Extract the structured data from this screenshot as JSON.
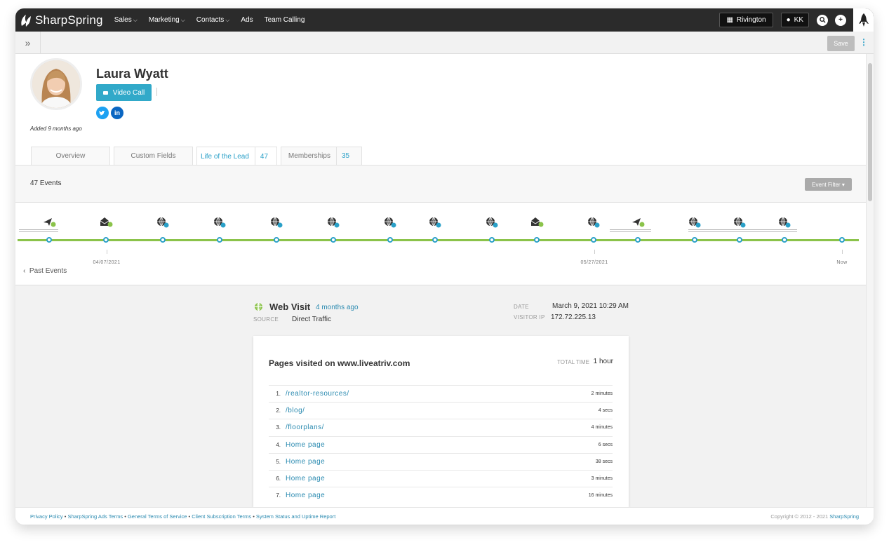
{
  "app": {
    "logo_text": "SharpSpring"
  },
  "nav": {
    "items": [
      {
        "label": "Sales",
        "dropdown": true
      },
      {
        "label": "Marketing",
        "dropdown": true
      },
      {
        "label": "Contacts",
        "dropdown": true
      },
      {
        "label": "Ads",
        "dropdown": false
      },
      {
        "label": "Team Calling",
        "dropdown": false
      }
    ],
    "company": "Rivington",
    "user_initials": "KK"
  },
  "toolbar": {
    "expand_label": "»",
    "save_label": "Save"
  },
  "contact": {
    "name": "Laura Wyatt",
    "video_call_label": "Video Call",
    "added": "Added 9 months ago",
    "social": [
      "twitter",
      "linkedin"
    ]
  },
  "tabs": [
    {
      "label": "Overview",
      "count": ""
    },
    {
      "label": "Custom Fields",
      "count": ""
    },
    {
      "label": "Life of the Lead",
      "count": "47",
      "active": true
    },
    {
      "label": "Memberships",
      "count": "35"
    }
  ],
  "events": {
    "count_label": "47 Events",
    "filter_label": "Event Filter ▾"
  },
  "timeline": {
    "events": [
      "email-sent",
      "email-open",
      "web-visit",
      "web-visit",
      "web-visit",
      "web-visit",
      "web-visit",
      "web-visit",
      "web-visit",
      "email-open",
      "web-visit",
      "email-sent",
      "web-visit",
      "web-visit",
      "web-visit"
    ],
    "dates": [
      "04/07/2021",
      "05/27/2021",
      "Now"
    ],
    "past_label": "Past Events"
  },
  "detail": {
    "type": "Web Visit",
    "ago": "4 months ago",
    "source_label": "SOURCE",
    "source": "Direct Traffic",
    "date_label": "DATE",
    "date": "March 9, 2021 10:29 AM",
    "ip_label": "VISITOR IP",
    "ip": "172.72.225.13"
  },
  "pages_card": {
    "title": "Pages visited on www.liveatriv.com",
    "total_label": "TOTAL TIME",
    "total": "1 hour",
    "rows": [
      {
        "num": "1.",
        "page": "/realtor-resources/",
        "dur": "2 minutes"
      },
      {
        "num": "2.",
        "page": "/blog/",
        "dur": "4 secs"
      },
      {
        "num": "3.",
        "page": "/floorplans/",
        "dur": "4 minutes"
      },
      {
        "num": "4.",
        "page": "Home page",
        "dur": "6 secs"
      },
      {
        "num": "5.",
        "page": "Home page",
        "dur": "38 secs"
      },
      {
        "num": "6.",
        "page": "Home page",
        "dur": "3 minutes"
      },
      {
        "num": "7.",
        "page": "Home page",
        "dur": "16 minutes"
      }
    ]
  },
  "footer": {
    "links": [
      "Privacy Policy",
      "SharpSpring Ads Terms",
      "General Terms of Service",
      "Client Subscription Terms",
      "System Status and Uptime Report"
    ],
    "copyright": "Copyright © 2012 - 2021",
    "brand": "SharpSpring"
  },
  "colors": {
    "accent": "#2aa0c8",
    "green": "#8bc34a",
    "nav_bg": "#2b2b2b"
  }
}
